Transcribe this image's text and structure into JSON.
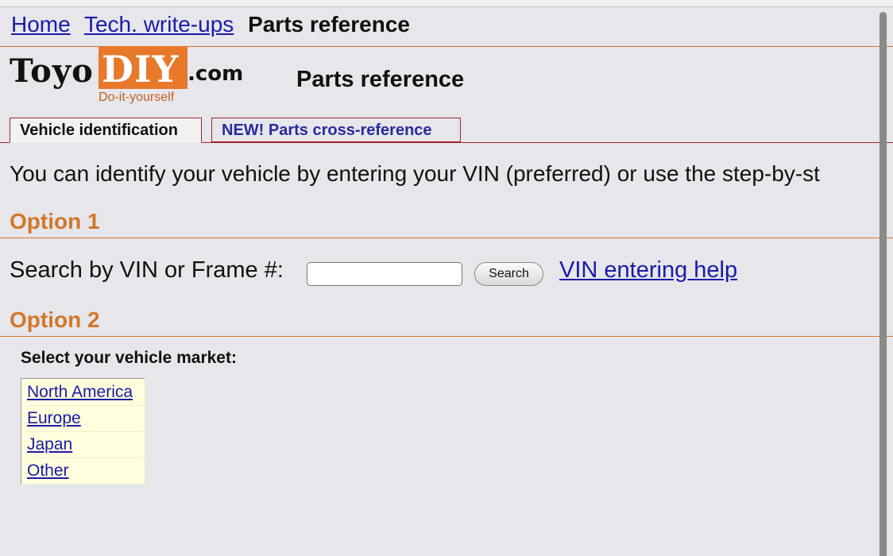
{
  "breadcrumb": {
    "home": "Home",
    "writeups": "Tech. write-ups",
    "current": "Parts reference"
  },
  "logo": {
    "toyo": "Toyo",
    "diy": "DIY",
    "dotcom": ".com",
    "tagline": "Do-it-yourself"
  },
  "page_title": "Parts reference",
  "tabs": [
    {
      "label": "Vehicle identification",
      "active": true
    },
    {
      "label": "NEW! Parts cross-reference",
      "active": false
    }
  ],
  "intro": "You can identify your vehicle by entering your VIN (preferred) or use the step-by-st",
  "option1": {
    "heading": "Option 1",
    "search_label": "Search by VIN or Frame #:",
    "input_value": "",
    "search_button": "Search",
    "help_link": "VIN entering help"
  },
  "option2": {
    "heading": "Option 2",
    "market_label": "Select your vehicle market:",
    "markets": [
      "North America",
      "Europe",
      "Japan",
      "Other"
    ]
  },
  "colors": {
    "accent": "#d2772a",
    "link": "#1a1aa8",
    "tab_border": "#a0262a",
    "market_bg": "#ffffdd"
  }
}
